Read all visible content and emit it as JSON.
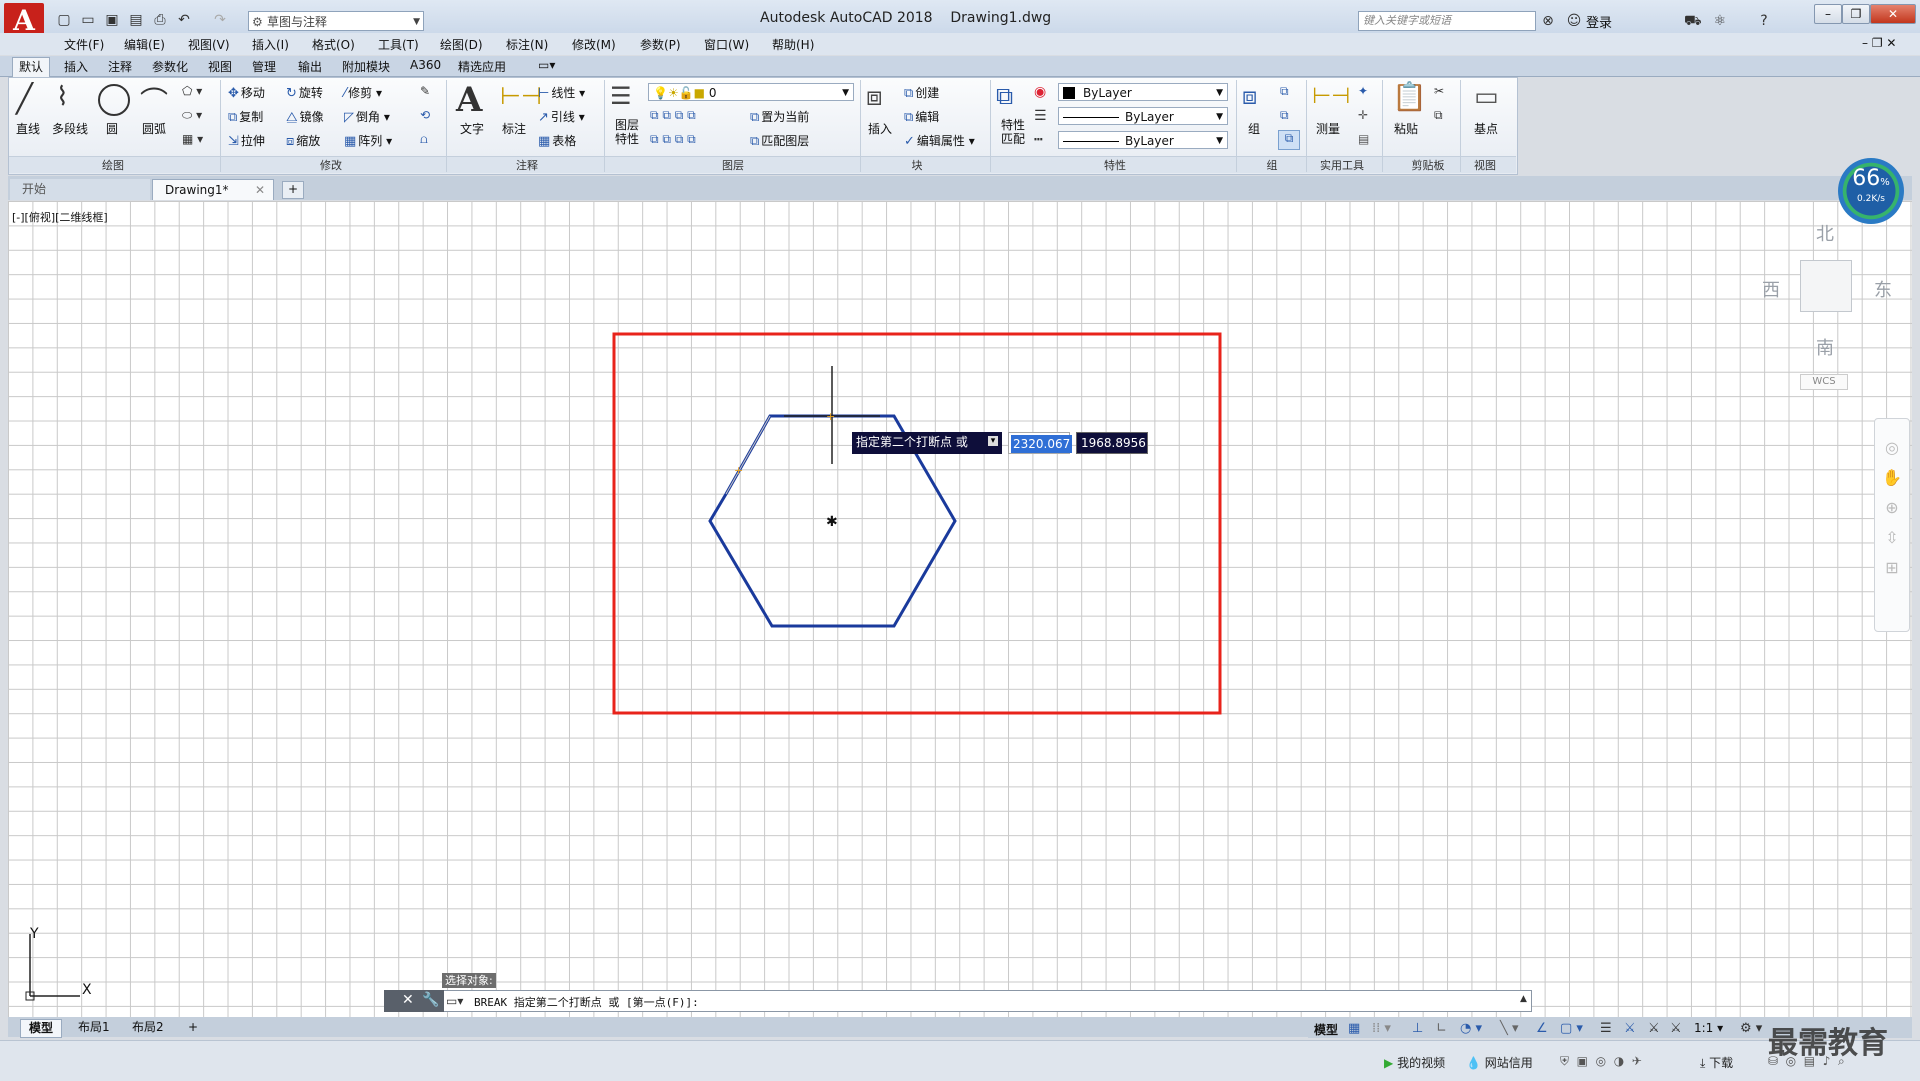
{
  "window": {
    "app_title": "Autodesk AutoCAD 2018",
    "file_title": "Drawing1.dwg",
    "workspace": "草图与注释",
    "search_placeholder": "键入关键字或短语",
    "login_label": "登录",
    "logo_letter": "A"
  },
  "menu": [
    "文件(F)",
    "编辑(E)",
    "视图(V)",
    "插入(I)",
    "格式(O)",
    "工具(T)",
    "绘图(D)",
    "标注(N)",
    "修改(M)",
    "参数(P)",
    "窗口(W)",
    "帮助(H)"
  ],
  "ribbon_tabs": [
    "默认",
    "插入",
    "注释",
    "参数化",
    "视图",
    "管理",
    "输出",
    "附加模块",
    "A360",
    "精选应用"
  ],
  "ribbon": {
    "draw": {
      "title": "绘图",
      "tools": [
        "直线",
        "多段线",
        "圆",
        "圆弧"
      ]
    },
    "modify": {
      "title": "修改",
      "tools": [
        "移动",
        "旋转",
        "修剪",
        "复制",
        "镜像",
        "倒角",
        "拉伸",
        "缩放",
        "阵列"
      ]
    },
    "annotation": {
      "title": "注释",
      "tools": [
        "文字",
        "标注",
        "线性",
        "引线",
        "表格"
      ]
    },
    "layers": {
      "title": "图层",
      "layer_props": "图层特性",
      "current_layer": "0",
      "tools": [
        "置为当前",
        "匹配图层"
      ]
    },
    "block": {
      "title": "块",
      "insert": "插入",
      "tools": [
        "创建",
        "编辑",
        "编辑属性"
      ]
    },
    "properties": {
      "title": "特性",
      "match": "特性匹配",
      "color": "ByLayer",
      "linetype": "ByLayer",
      "lineweight": "ByLayer"
    },
    "groups": {
      "title": "组",
      "group": "组"
    },
    "utilities": {
      "title": "实用工具",
      "measure": "测量"
    },
    "clipboard": {
      "title": "剪贴板",
      "paste": "粘贴"
    },
    "view": {
      "title": "视图",
      "base": "基点"
    }
  },
  "doc_tabs": {
    "start": "开始",
    "drawing": "Drawing1*",
    "add": "+"
  },
  "viewport_label": "[-][俯视][二维线框]",
  "tooltip": {
    "prompt": "指定第二个打断点 或",
    "x_value": "2320.067",
    "y_value": "1968.8956"
  },
  "viewcube": {
    "north": "北",
    "south": "南",
    "east": "东",
    "west": "西",
    "wcs": "WCS"
  },
  "speed": {
    "percent": "66",
    "unit": "%",
    "rate": "0.2K/s"
  },
  "ucs": {
    "x": "X",
    "y": "Y"
  },
  "command": {
    "history": "选择对象:",
    "current": "BREAK 指定第二个打断点 或 [第一点(F)]:"
  },
  "layout_tabs": [
    "模型",
    "布局1",
    "布局2",
    "+"
  ],
  "status": {
    "model": "模型",
    "scale": "1:1"
  },
  "taskbar": {
    "video": "我的视频",
    "network": "网站信用",
    "download": "下载"
  },
  "watermark": "最需教育",
  "colors": {
    "selection_frame": "#e8231b",
    "hexagon": "#1a3a9c",
    "title_accent": "#c8211b"
  }
}
